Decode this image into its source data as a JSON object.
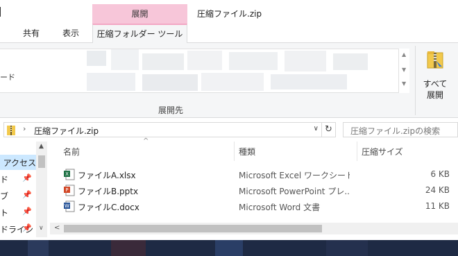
{
  "window": {
    "title": "圧縮ファイル.zip",
    "contextual_tab_header": "展開"
  },
  "tabs": [
    {
      "label": "共有"
    },
    {
      "label": "表示"
    },
    {
      "label": "圧縮フォルダー ツール"
    }
  ],
  "ribbon": {
    "gallery_partial_text": "ード",
    "group_label": "展開先",
    "extract_all_line1": "すべて",
    "extract_all_line2": "展開"
  },
  "address_bar": {
    "path": "圧縮ファイル.zip",
    "search_placeholder": "圧縮ファイル.zipの検索"
  },
  "nav_pane": {
    "items": [
      {
        "label": "アクセス",
        "selected": true
      },
      {
        "label": "ド",
        "pinned": true
      },
      {
        "label": "ブ",
        "pinned": true
      },
      {
        "label": "ト",
        "pinned": true
      },
      {
        "label": "ドライン",
        "pinned": true
      }
    ]
  },
  "file_list": {
    "columns": {
      "name": "名前",
      "type": "種類",
      "size": "圧縮サイズ"
    },
    "rows": [
      {
        "name": "ファイルA.xlsx",
        "type": "Microsoft Excel ワークシート",
        "size": "6 KB",
        "icon": "excel-file-icon"
      },
      {
        "name": "ファイルB.pptx",
        "type": "Microsoft PowerPoint プレ...",
        "size": "24 KB",
        "icon": "powerpoint-file-icon"
      },
      {
        "name": "ファイルC.docx",
        "type": "Microsoft Word 文書",
        "size": "11 KB",
        "icon": "word-file-icon"
      }
    ]
  },
  "colors": {
    "contextual_tab": "#f7c6d9",
    "selection": "#cce8ff",
    "taskbar": "#1e2a44"
  }
}
